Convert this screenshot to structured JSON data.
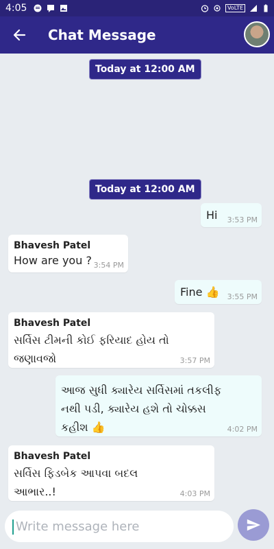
{
  "status_bar": {
    "time": "4:05",
    "network_label": "VoLTE",
    "signal": "4G"
  },
  "header": {
    "title": "Chat Message"
  },
  "chat": {
    "date_pills": [
      "Today at 12:00 AM",
      "Today at 12:00 AM"
    ],
    "messages": [
      {
        "direction": "out",
        "text": "Hi",
        "time": "3:53 PM"
      },
      {
        "direction": "in",
        "sender": "Bhavesh Patel",
        "text": "How are you ?",
        "time": "3:54 PM"
      },
      {
        "direction": "out",
        "text": "Fine 👍",
        "time": "3:55 PM"
      },
      {
        "direction": "in",
        "sender": "Bhavesh Patel",
        "line1": "સર્વિસ ટીમની કોઈ ફરિયાદ હોય તો",
        "line2": "જણાવજો",
        "time": "3:57 PM"
      },
      {
        "direction": "out",
        "line1": "આજ સુધી ક્યારેય સર્વિસમાં તકલીફ",
        "line2": "નથી પડી, ક્યારેય હશે તો ચોક્કસ",
        "line3": "કહીશ 👍",
        "time": "4:02 PM"
      },
      {
        "direction": "in",
        "sender": "Bhavesh Patel",
        "line1": "સર્વિસ ફિડબેક આપવા બદલ",
        "line2": "આભાર..!",
        "time": "4:03 PM"
      }
    ]
  },
  "composer": {
    "placeholder": "Write message here"
  },
  "colors": {
    "primary": "#2f2889",
    "background": "#e8ecf0",
    "outgoing_bubble": "#eefcfc",
    "incoming_bubble": "#ffffff",
    "send_button": "#9a9bd4"
  }
}
